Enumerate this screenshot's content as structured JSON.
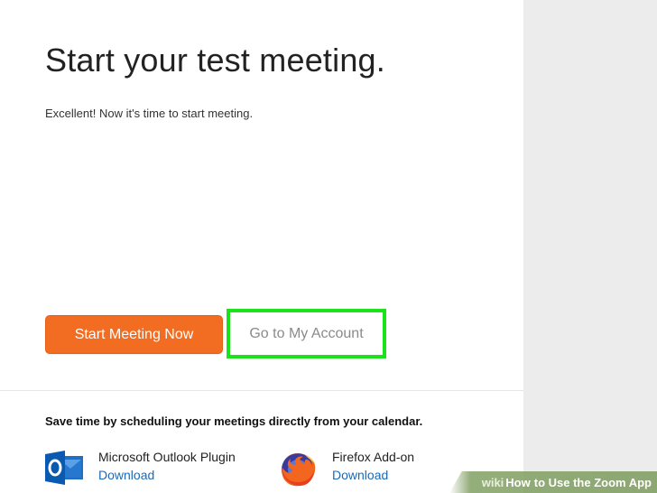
{
  "page": {
    "title": "Start your test meeting.",
    "subtitle": "Excellent! Now it's time to start meeting."
  },
  "actions": {
    "start_label": "Start Meeting Now",
    "account_label": "Go to My Account"
  },
  "calendar": {
    "heading": "Save time by scheduling your meetings directly from your calendar.",
    "plugins": [
      {
        "name": "Microsoft Outlook Plugin",
        "link": "Download",
        "icon": "outlook-icon"
      },
      {
        "name": "Firefox Add-on",
        "link": "Download",
        "icon": "firefox-icon"
      }
    ]
  },
  "watermark": {
    "wiki": "wiki",
    "how": "How",
    "title": "to Use the Zoom App"
  },
  "colors": {
    "start_button": "#f26d21",
    "highlight": "#1be31b",
    "link": "#1a6ab8",
    "side_panel": "#ececed"
  }
}
